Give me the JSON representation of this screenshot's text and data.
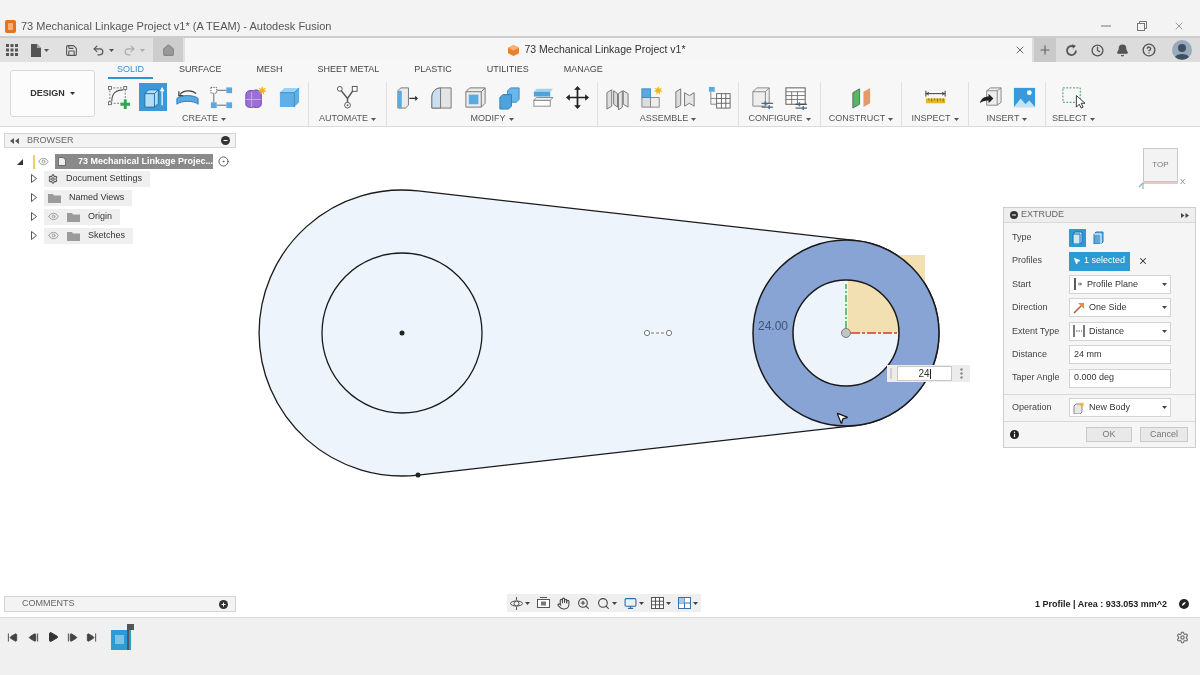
{
  "window": {
    "title": "73 Mechanical Linkage Project v1* (A TEAM) - Autodesk Fusion"
  },
  "document_tab": {
    "title": "73 Mechanical Linkage Project v1*"
  },
  "workspace": {
    "label": "DESIGN"
  },
  "toolbar_tabs": [
    {
      "label": "SOLID",
      "selected": true
    },
    {
      "label": "SURFACE",
      "selected": false
    },
    {
      "label": "MESH",
      "selected": false
    },
    {
      "label": "SHEET METAL",
      "selected": false
    },
    {
      "label": "PLASTIC",
      "selected": false
    },
    {
      "label": "UTILITIES",
      "selected": false
    },
    {
      "label": "MANAGE",
      "selected": false
    }
  ],
  "tool_groups": [
    {
      "label": "CREATE",
      "tools": [
        {
          "kind": "sketch",
          "active": false
        },
        {
          "kind": "extrude",
          "active": true
        },
        {
          "kind": "revolve",
          "active": false
        },
        {
          "kind": "pattern",
          "active": false
        },
        {
          "kind": "form",
          "active": false
        },
        {
          "kind": "box",
          "active": false
        }
      ]
    },
    {
      "label": "AUTOMATE",
      "tools": [
        {
          "kind": "automate",
          "active": false
        }
      ]
    },
    {
      "label": "MODIFY",
      "tools": [
        {
          "kind": "press_pull",
          "active": false
        },
        {
          "kind": "fillet",
          "active": false
        },
        {
          "kind": "shell",
          "active": false
        },
        {
          "kind": "combine",
          "active": false
        },
        {
          "kind": "offset",
          "active": false
        },
        {
          "kind": "move",
          "active": false
        }
      ]
    },
    {
      "label": "ASSEMBLE",
      "tools": [
        {
          "kind": "joint",
          "active": false
        },
        {
          "kind": "new_component",
          "active": false
        },
        {
          "kind": "as_built",
          "active": false
        },
        {
          "kind": "table",
          "active": false
        }
      ]
    },
    {
      "label": "CONFIGURE",
      "tools": [
        {
          "kind": "configure",
          "active": false
        },
        {
          "kind": "config_table",
          "active": false
        }
      ]
    },
    {
      "label": "CONSTRUCT",
      "tools": [
        {
          "kind": "plane",
          "active": false
        }
      ]
    },
    {
      "label": "INSPECT",
      "tools": [
        {
          "kind": "measure",
          "active": false
        }
      ]
    },
    {
      "label": "INSERT",
      "tools": [
        {
          "kind": "insert",
          "active": false
        },
        {
          "kind": "image",
          "active": false
        }
      ]
    },
    {
      "label": "SELECT",
      "tools": [
        {
          "kind": "select",
          "active": false
        }
      ]
    }
  ],
  "browser": {
    "title": "BROWSER",
    "root": {
      "label": "73 Mechanical Linkage Projec...",
      "expanded": true,
      "visibility_toggle": true,
      "children": [
        {
          "label": "Document Settings",
          "kind": "settings",
          "expanded": false,
          "visibility_toggle": false
        },
        {
          "label": "Named Views",
          "kind": "folder",
          "expanded": false,
          "visibility_toggle": false
        },
        {
          "label": "Origin",
          "kind": "folder",
          "expanded": false,
          "visibility_toggle": true
        },
        {
          "label": "Sketches",
          "kind": "folder",
          "expanded": false,
          "visibility_toggle": true
        }
      ]
    }
  },
  "canvas": {
    "view_cube": {
      "face": "TOP",
      "axis_label": "X"
    },
    "dimension": {
      "label": "24.00",
      "input_value": "24"
    }
  },
  "extrude": {
    "title": "EXTRUDE",
    "rows": [
      {
        "kind": "type",
        "label": "Type",
        "options": [
          {
            "selected": true
          },
          {
            "selected": false
          }
        ]
      },
      {
        "kind": "selection",
        "label": "Profiles",
        "value": "1 selected"
      },
      {
        "kind": "dropdown",
        "label": "Start",
        "value": "Profile Plane"
      },
      {
        "kind": "dropdown",
        "label": "Direction",
        "value": "One Side"
      },
      {
        "kind": "dropdown",
        "label": "Extent Type",
        "value": "Distance"
      },
      {
        "kind": "input",
        "label": "Distance",
        "value": "24 mm"
      },
      {
        "kind": "input",
        "label": "Taper Angle",
        "value": "0.000 deg"
      }
    ],
    "operation": {
      "label": "Operation",
      "value": "New Body"
    },
    "buttons": [
      "OK",
      "Cancel"
    ]
  },
  "comments": {
    "title": "COMMENTS"
  },
  "status": {
    "text": "1 Profile | Area : 933.053 mm^2"
  }
}
